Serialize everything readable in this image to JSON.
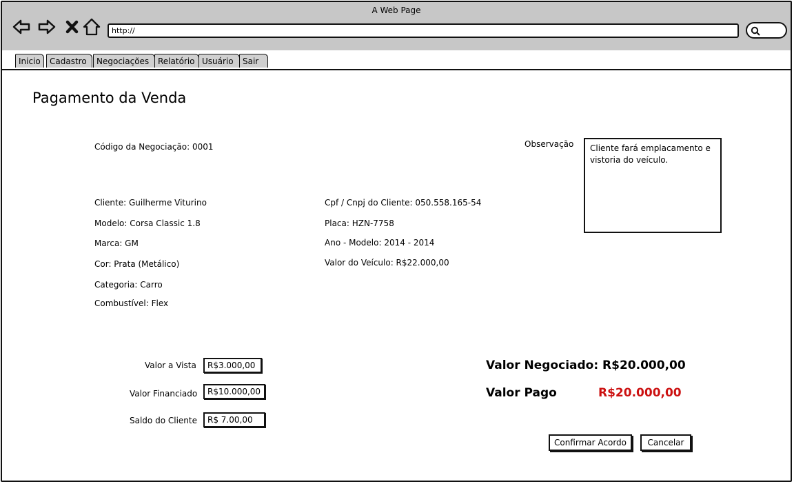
{
  "browser": {
    "title": "A Web Page",
    "url": "http://"
  },
  "tabs": [
    "Inicio",
    "Cadastro",
    "Negociações",
    "Relatório",
    "Usuário",
    "Sair"
  ],
  "page": {
    "title": "Pagamento da Venda"
  },
  "negotiation": {
    "code": "Código da Negociação:  0001",
    "observation_label": "Observação",
    "observation_text": "Cliente fará emplacamento e vistoria do veículo."
  },
  "client": {
    "name": "Cliente: Guilherme Viturino",
    "model": "Modelo: Corsa Classic 1.8",
    "brand": "Marca: GM",
    "color": "Cor: Prata (Metálico)",
    "category": "Categoria: Carro",
    "fuel": "Combustível: Flex",
    "cpf": "Cpf / Cnpj do Cliente: 050.558.165-54",
    "plate": "Placa: HZN-7758",
    "year": "Ano - Modelo:  2014 - 2014",
    "value": "Valor do Veículo: R$22.000,00"
  },
  "payment": {
    "cash_label": "Valor a Vista",
    "cash_value": "R$3.000,00",
    "financed_label": "Valor Financiado",
    "financed_value": "R$10.000,00",
    "balance_label": "Saldo do Cliente",
    "balance_value": "R$ 7.00,00"
  },
  "totals": {
    "negotiated": "Valor Negociado: R$20.000,00",
    "paid_label": "Valor Pago",
    "paid_value": "R$20.000,00",
    "paid_color": "#cc1111"
  },
  "actions": {
    "confirm": "Confirmar Acordo",
    "cancel": "Cancelar"
  }
}
